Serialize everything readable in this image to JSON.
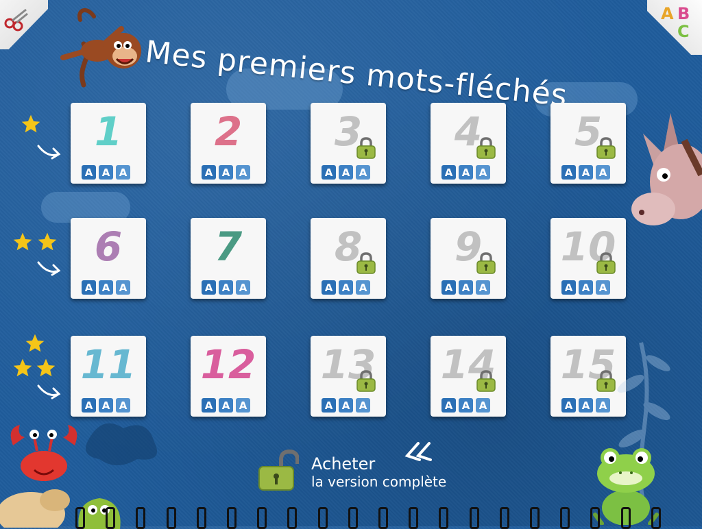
{
  "title": "Mes premiers mots-fléchés",
  "corner_abc": [
    "A",
    "B",
    "C"
  ],
  "colors": {
    "background": "#1f5c9c",
    "letter_box": "#2a6fb5",
    "lock": "#9bb944"
  },
  "levels": [
    {
      "number": "1",
      "color": "#46c9c0",
      "locked": false,
      "letters": [
        "A",
        "A",
        "A"
      ]
    },
    {
      "number": "2",
      "color": "#d95a78",
      "locked": false,
      "letters": [
        "A",
        "A",
        "A"
      ]
    },
    {
      "number": "3",
      "color": "#b8b8b8",
      "locked": true,
      "letters": [
        "A",
        "A",
        "A"
      ]
    },
    {
      "number": "4",
      "color": "#b8b8b8",
      "locked": true,
      "letters": [
        "A",
        "A",
        "A"
      ]
    },
    {
      "number": "5",
      "color": "#b8b8b8",
      "locked": true,
      "letters": [
        "A",
        "A",
        "A"
      ]
    },
    {
      "number": "6",
      "color": "#a06aa8",
      "locked": false,
      "letters": [
        "A",
        "A",
        "A"
      ]
    },
    {
      "number": "7",
      "color": "#2c8a6f",
      "locked": false,
      "letters": [
        "A",
        "A",
        "A"
      ]
    },
    {
      "number": "8",
      "color": "#b8b8b8",
      "locked": true,
      "letters": [
        "A",
        "A",
        "A"
      ]
    },
    {
      "number": "9",
      "color": "#b8b8b8",
      "locked": true,
      "letters": [
        "A",
        "A",
        "A"
      ]
    },
    {
      "number": "10",
      "color": "#b8b8b8",
      "locked": true,
      "letters": [
        "A",
        "A",
        "A"
      ]
    },
    {
      "number": "11",
      "color": "#4eaecb",
      "locked": false,
      "letters": [
        "A",
        "A",
        "A"
      ]
    },
    {
      "number": "12",
      "color": "#d4448e",
      "locked": false,
      "letters": [
        "A",
        "A",
        "A"
      ]
    },
    {
      "number": "13",
      "color": "#b8b8b8",
      "locked": true,
      "letters": [
        "A",
        "A",
        "A"
      ]
    },
    {
      "number": "14",
      "color": "#b8b8b8",
      "locked": true,
      "letters": [
        "A",
        "A",
        "A"
      ]
    },
    {
      "number": "15",
      "color": "#b8b8b8",
      "locked": true,
      "letters": [
        "A",
        "A",
        "A"
      ]
    }
  ],
  "row_stars": [
    1,
    2,
    3
  ],
  "buy": {
    "line1": "Acheter",
    "line2": "la version complète"
  }
}
